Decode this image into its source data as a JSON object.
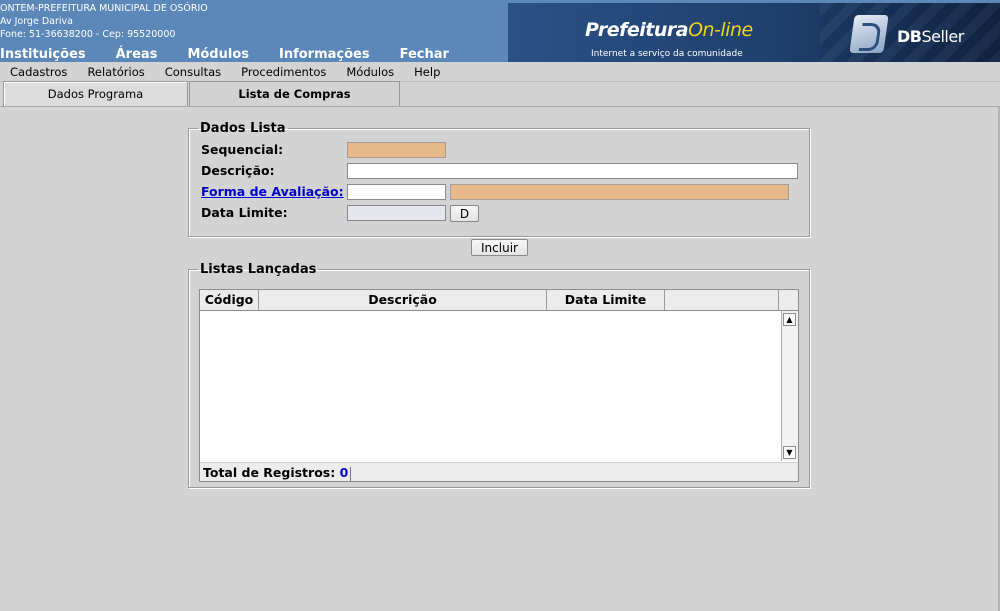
{
  "header": {
    "line1": "ONTEM-PREFEITURA MUNICIPAL DE OSÓRIO",
    "line2": "Av Jorge Dariva",
    "line3": "Fone: 51-36638200  -  Cep: 95520000",
    "nav": [
      "Instituições",
      "Áreas",
      "Módulos",
      "Informações",
      "Fechar"
    ],
    "banner": {
      "logo_main": "Prefeitura",
      "logo_online": "On-line",
      "logo_sub": "Internet a serviço da comunidade",
      "vendor_bold": "DB",
      "vendor_rest": "Seller"
    }
  },
  "menu": [
    "Cadastros",
    "Relatórios",
    "Consultas",
    "Procedimentos",
    "Módulos",
    "Help"
  ],
  "tabs": [
    {
      "label": "Dados Programa",
      "active": false
    },
    {
      "label": "Lista de Compras",
      "active": true
    }
  ],
  "form": {
    "legend": "Dados Lista",
    "sequencial_label": "Sequencial:",
    "sequencial_value": "",
    "descricao_label": "Descrição:",
    "descricao_value": "",
    "forma_label": "Forma de Avaliação:",
    "forma_code": "",
    "forma_desc": "",
    "data_label": "Data Limite:",
    "data_value": "",
    "date_button": "D",
    "include_button": "Incluir"
  },
  "list": {
    "legend": "Listas Lançadas",
    "columns": [
      "Código",
      "Descrição",
      "Data Limite",
      ""
    ],
    "rows": [],
    "total_label": "Total de Registros:",
    "total_value": "0"
  },
  "colors": {
    "header_bg": "#5b87b9",
    "readonly_field": "#e7b98a",
    "link": "#0000cc"
  }
}
